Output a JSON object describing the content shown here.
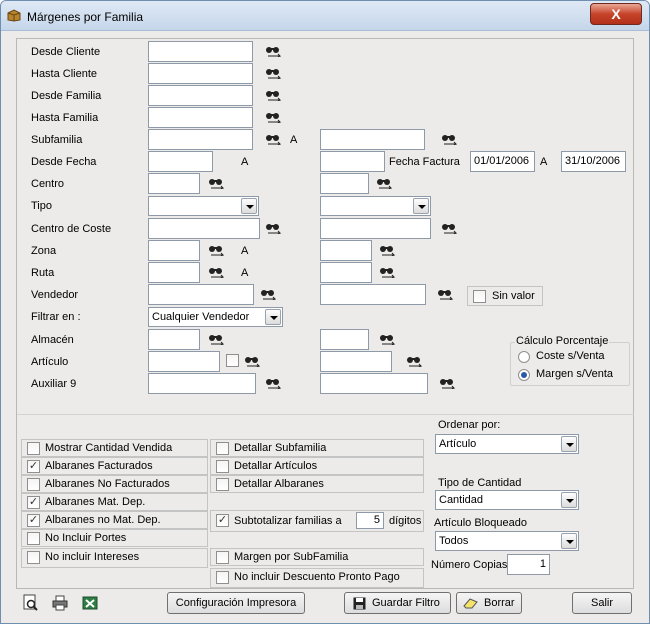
{
  "window": {
    "title": "Márgenes por Familia",
    "close_label": "X"
  },
  "filters": {
    "desde_cliente": "Desde Cliente",
    "hasta_cliente": "Hasta Cliente",
    "desde_familia": "Desde Familia",
    "hasta_familia": "Hasta Familia",
    "subfamilia": "Subfamilia",
    "desde_fecha": "Desde Fecha",
    "centro": "Centro",
    "tipo": "Tipo",
    "centro_coste": "Centro de Coste",
    "zona": "Zona",
    "ruta": "Ruta",
    "vendedor": "Vendedor",
    "filtrar_en": "Filtrar en :",
    "almacen": "Almacén",
    "articulo": "Artículo",
    "auxiliar9": "Auxiliar 9",
    "a_label": "A",
    "fecha_factura_label": "Fecha Factura",
    "fecha_desde_value": "01/01/2006",
    "fecha_hasta_value": "31/10/2006",
    "sin_valor": "Sin valor",
    "filtrar_en_value": "Cualquier Vendedor"
  },
  "calculo": {
    "title": "Cálculo Porcentaje",
    "coste": "Coste s/Venta",
    "margen": "Margen s/Venta",
    "selected": "margen"
  },
  "options_left": [
    {
      "label": "Mostrar Cantidad Vendida",
      "checked": false
    },
    {
      "label": "Albaranes Facturados",
      "checked": true
    },
    {
      "label": "Albaranes No Facturados",
      "checked": false
    },
    {
      "label": "Albaranes Mat. Dep.",
      "checked": true
    },
    {
      "label": "Albaranes no Mat. Dep.",
      "checked": true
    },
    {
      "label": "No Incluir Portes",
      "checked": false
    },
    {
      "label": "No incluir Intereses",
      "checked": false
    }
  ],
  "options_right": [
    {
      "label": "Detallar Subfamilia",
      "checked": false
    },
    {
      "label": "Detallar Artículos",
      "checked": false
    },
    {
      "label": "Detallar Albaranes",
      "checked": false
    },
    {
      "label": "Subtotalizar familias a",
      "checked": true
    },
    {
      "label": "Margen por SubFamilia",
      "checked": false
    },
    {
      "label": "No incluir Descuento Pronto Pago",
      "checked": false
    }
  ],
  "subtotal": {
    "value": "5",
    "suffix": "dígitos"
  },
  "ordenar": {
    "label": "Ordenar por:",
    "value": "Artículo"
  },
  "tipo_cantidad": {
    "label": "Tipo de Cantidad",
    "value": "Cantidad"
  },
  "art_bloqueado": {
    "label": "Artículo Bloqueado",
    "value": "Todos"
  },
  "num_copias": {
    "label": "Número Copias",
    "value": "1"
  },
  "buttons": {
    "config": "Configuración Impresora",
    "guardar": "Guardar Filtro",
    "borrar": "Borrar",
    "salir": "Salir"
  }
}
